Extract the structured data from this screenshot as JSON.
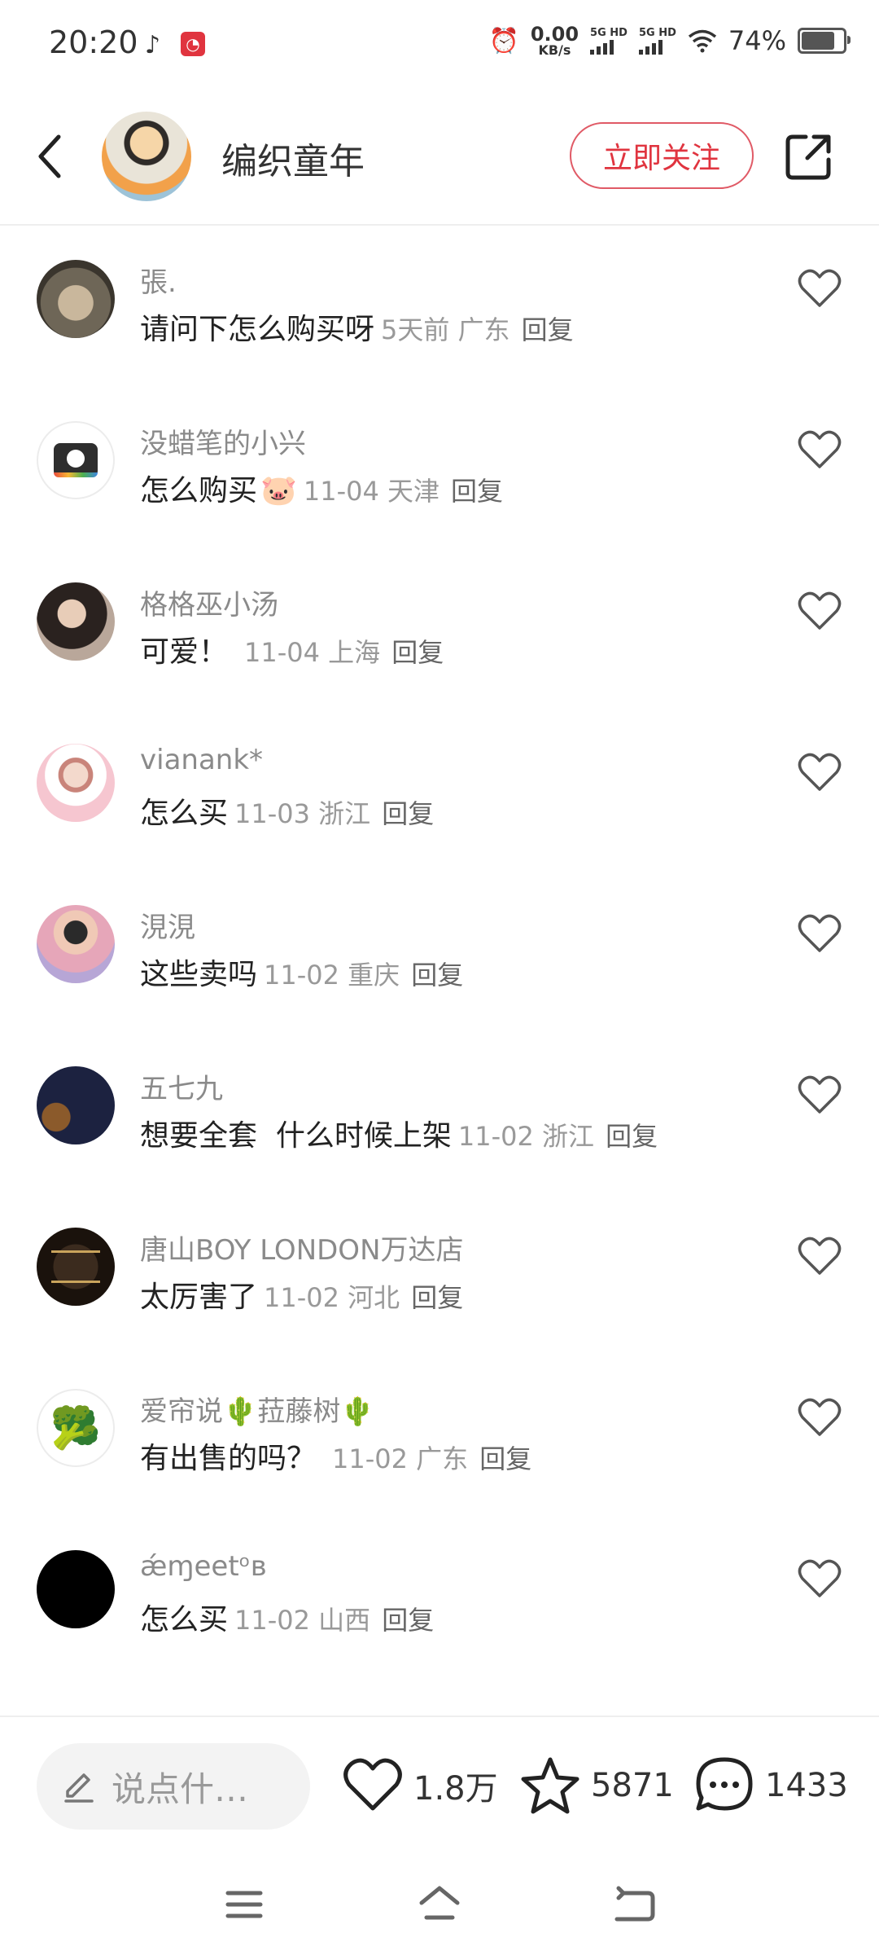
{
  "status_bar": {
    "time": "20:20",
    "net_speed_value": "0.00",
    "net_speed_unit": "KB/s",
    "sig1_label": "5G HD",
    "sig2_label": "5G HD",
    "battery_pct": "74%",
    "battery_level": 0.74
  },
  "header": {
    "author_name": "编织童年",
    "follow_label": "立即关注"
  },
  "comments": [
    {
      "name": "張.",
      "text": "请问下怎么购买呀",
      "meta": "5天前  广东",
      "reply": "回复"
    },
    {
      "name": "没蜡笔的小兴",
      "text": "怎么购买",
      "emoji": "🐷",
      "meta": "11-04 天津",
      "reply": "回复"
    },
    {
      "name": "格格巫小汤",
      "text": "可爱！",
      "meta": "11-04 上海",
      "reply": "回复"
    },
    {
      "name": "vianank*",
      "text": "怎么买",
      "meta": "11-03 浙江",
      "reply": "回复"
    },
    {
      "name": "涀涀",
      "text": "这些卖吗",
      "meta": "11-02 重庆",
      "reply": "回复"
    },
    {
      "name": "五七九",
      "text": "想要全套  什么时候上架",
      "meta": "11-02 浙江",
      "reply": "回复"
    },
    {
      "name": "唐山BOY LONDON万达店",
      "text": "太厉害了",
      "meta": "11-02 河北",
      "reply": "回复"
    },
    {
      "name": "爱帘说🌵菈藤树🌵",
      "text": "有出售的吗？",
      "meta": "11-02 广东",
      "reply": "回复"
    },
    {
      "name": "ǽɱeetᵒʙ",
      "text": "怎么买",
      "meta": "11-02 山西",
      "reply": "回复"
    }
  ],
  "bottom_bar": {
    "input_placeholder": "说点什…",
    "likes": "1.8万",
    "favorites": "5871",
    "comments": "1433"
  }
}
